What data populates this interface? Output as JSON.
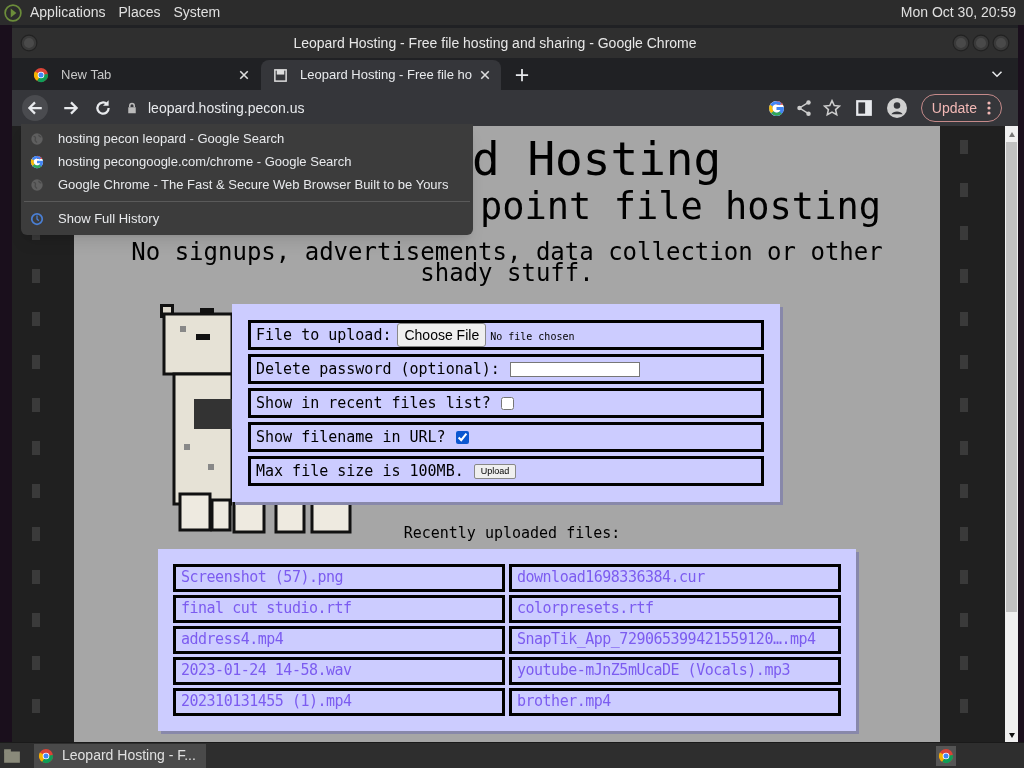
{
  "desktop_panel": {
    "menus": [
      "Applications",
      "Places",
      "System"
    ],
    "clock": "Mon Oct 30, 20:59"
  },
  "window": {
    "title": "Leopard Hosting - Free file hosting and sharing - Google Chrome"
  },
  "tabs": [
    {
      "label": "New Tab",
      "selected": false
    },
    {
      "label": "Leopard Hosting - Free file ho",
      "selected": true
    }
  ],
  "address_bar": {
    "url": "leopard.hosting.pecon.us",
    "update_button": "Update"
  },
  "omnibox_suggestions": [
    {
      "text": "hosting pecon leopard - Google Search"
    },
    {
      "text": "hosting pecongoogle.com/chrome - Google Search"
    },
    {
      "text": "Google Chrome - The Fast & Secure Web Browser Built to be Yours"
    }
  ],
  "show_full_history": "Show Full History",
  "page": {
    "heading": [
      "d Hosting",
      "point file hosting"
    ],
    "tagline": "No signups, advertisements, data collection or other shady stuff.",
    "form": [
      {
        "kind": "file",
        "label": "File to upload:",
        "button": "Choose File",
        "status": "No file chosen"
      },
      {
        "kind": "password",
        "label": "Delete password (optional):"
      },
      {
        "kind": "checkbox",
        "label": "Show in recent files list?",
        "checked": false
      },
      {
        "kind": "checkbox",
        "label": "Show filename in URL?",
        "checked": true
      },
      {
        "kind": "submit",
        "label": "Max file size is 100MB.",
        "button": "Upload"
      }
    ],
    "recent_title": "Recently uploaded files:",
    "recent_files": [
      "Screenshot (57).png",
      "download1698336384.cur",
      "final cut studio.rtf",
      "colorpresets.rtf",
      "address4.mp4",
      "SnapTik_App_729065399421559120….mp4",
      "2023-01-24 14-58.wav",
      "youtube-mJnZ5mUcaDE (Vocals).mp3",
      "202310131455 (1).mp4",
      "brother.mp4"
    ]
  },
  "taskbar": {
    "tasks": [
      {
        "label": "Leopard Hosting - F...",
        "selected": true
      }
    ]
  }
}
